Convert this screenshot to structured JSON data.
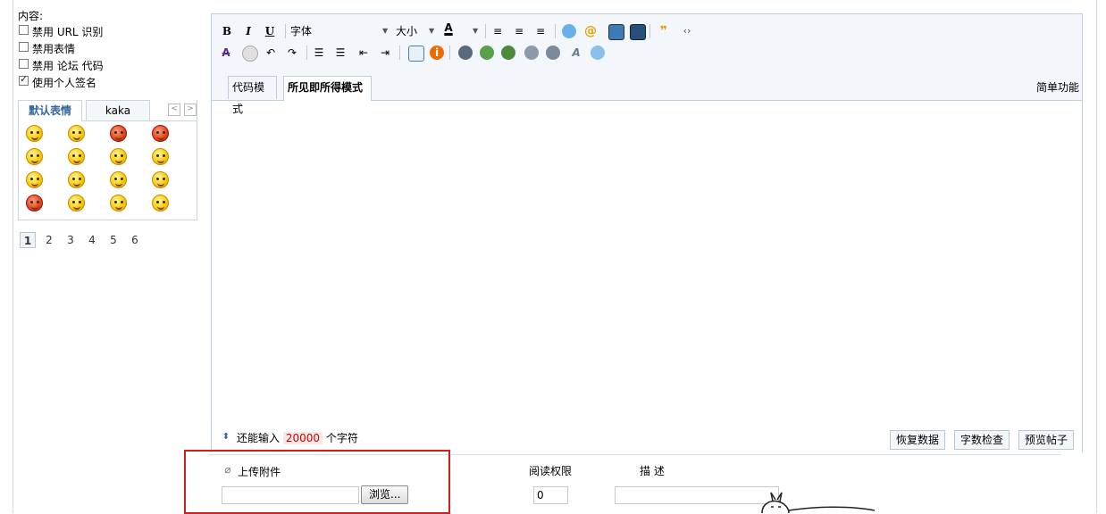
{
  "content_label": "内容:",
  "options": [
    {
      "label": "禁用 URL 识别",
      "checked": false
    },
    {
      "label": "禁用表情",
      "checked": false
    },
    {
      "label": "禁用 论坛 代码",
      "checked": false
    },
    {
      "label": "使用个人签名",
      "checked": true
    }
  ],
  "smilies": {
    "tabs": [
      "默认表情",
      "kaka"
    ],
    "prev": "<",
    "next": ">",
    "pages": [
      "1",
      "2",
      "3",
      "4",
      "5",
      "6"
    ]
  },
  "toolbar": {
    "bold": "B",
    "italic": "I",
    "underline": "U",
    "font": "字体",
    "size": "大小",
    "color": "A"
  },
  "editor": {
    "tabs": [
      "代码模式",
      "所见即所得模式"
    ],
    "simple": "简单功能"
  },
  "status": {
    "prefix": "还能输入",
    "count": "20000",
    "suffix": "个字符",
    "buttons": [
      "恢复数据",
      "字数检查",
      "预览帖子"
    ]
  },
  "attachment": {
    "upload_label": "上传附件",
    "browse": "浏览...",
    "permission_label": "阅读权限",
    "permission_value": "0",
    "description_label": "描 述"
  },
  "colors": {
    "highlight": "#d01e1e",
    "accent": "#336699"
  }
}
